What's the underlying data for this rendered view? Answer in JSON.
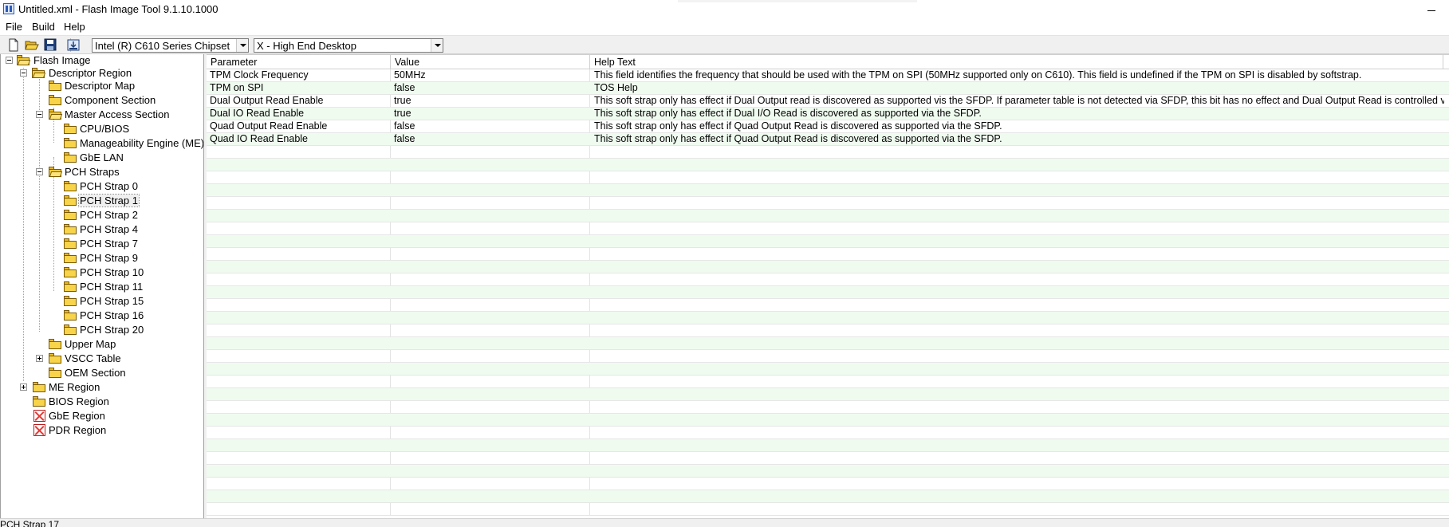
{
  "window": {
    "title": "Untitled.xml - Flash Image Tool 9.1.10.1000"
  },
  "menu": [
    "File",
    "Build",
    "Help"
  ],
  "toolbar": {
    "chipset": "Intel (R) C610 Series Chipset",
    "sku": "X - High End Desktop"
  },
  "tree": {
    "root": "Flash Image",
    "descriptor_region": "Descriptor Region",
    "descriptor_map": "Descriptor Map",
    "component_section": "Component Section",
    "master_access_section": "Master Access Section",
    "cpu_bios": "CPU/BIOS",
    "manageability_engine": "Manageability Engine (ME)",
    "gbe_lan": "GbE LAN",
    "pch_straps": "PCH Straps",
    "straps": [
      "PCH Strap 0",
      "PCH Strap 1",
      "PCH Strap 2",
      "PCH Strap 4",
      "PCH Strap 7",
      "PCH Strap 9",
      "PCH Strap 10",
      "PCH Strap 11",
      "PCH Strap 15",
      "PCH Strap 16",
      "PCH Strap 20"
    ],
    "upper_map": "Upper Map",
    "vscc_table": "VSCC Table",
    "oem_section": "OEM Section",
    "me_region": "ME Region",
    "bios_region": "BIOS Region",
    "gbe_region": "GbE Region",
    "pdr_region": "PDR Region"
  },
  "grid": {
    "headers": [
      "Parameter",
      "Value",
      "Help Text"
    ],
    "rows": [
      {
        "parameter": "TPM Clock Frequency",
        "value": "50MHz",
        "help": "This field identifies the frequency that should be used with the TPM on SPI (50MHz supported only on C610). This field is undefined if the TPM on SPI is disabled by softstrap."
      },
      {
        "parameter": "TPM on SPI",
        "value": "false",
        "help": "TOS Help"
      },
      {
        "parameter": "Dual Output Read Enable",
        "value": "true",
        "help": "This soft strap only has effect if Dual Output read is discovered as supported vis the SFDP. If parameter table is not detected via SFDP, this bit has no effect and Dual Output Read is controlled via the Fla..."
      },
      {
        "parameter": "Dual IO Read Enable",
        "value": "true",
        "help": "This soft strap only has effect if Dual I/O Read is discovered as supported via the SFDP."
      },
      {
        "parameter": "Quad Output Read Enable",
        "value": "false",
        "help": "This soft strap only has effect if Quad Output Read is discovered as supported via the SFDP."
      },
      {
        "parameter": "Quad IO Read Enable",
        "value": "false",
        "help": "This soft strap only has effect if Quad Output Read is discovered as supported via the SFDP."
      }
    ]
  },
  "status": {
    "text": "PCH Strap 17"
  }
}
